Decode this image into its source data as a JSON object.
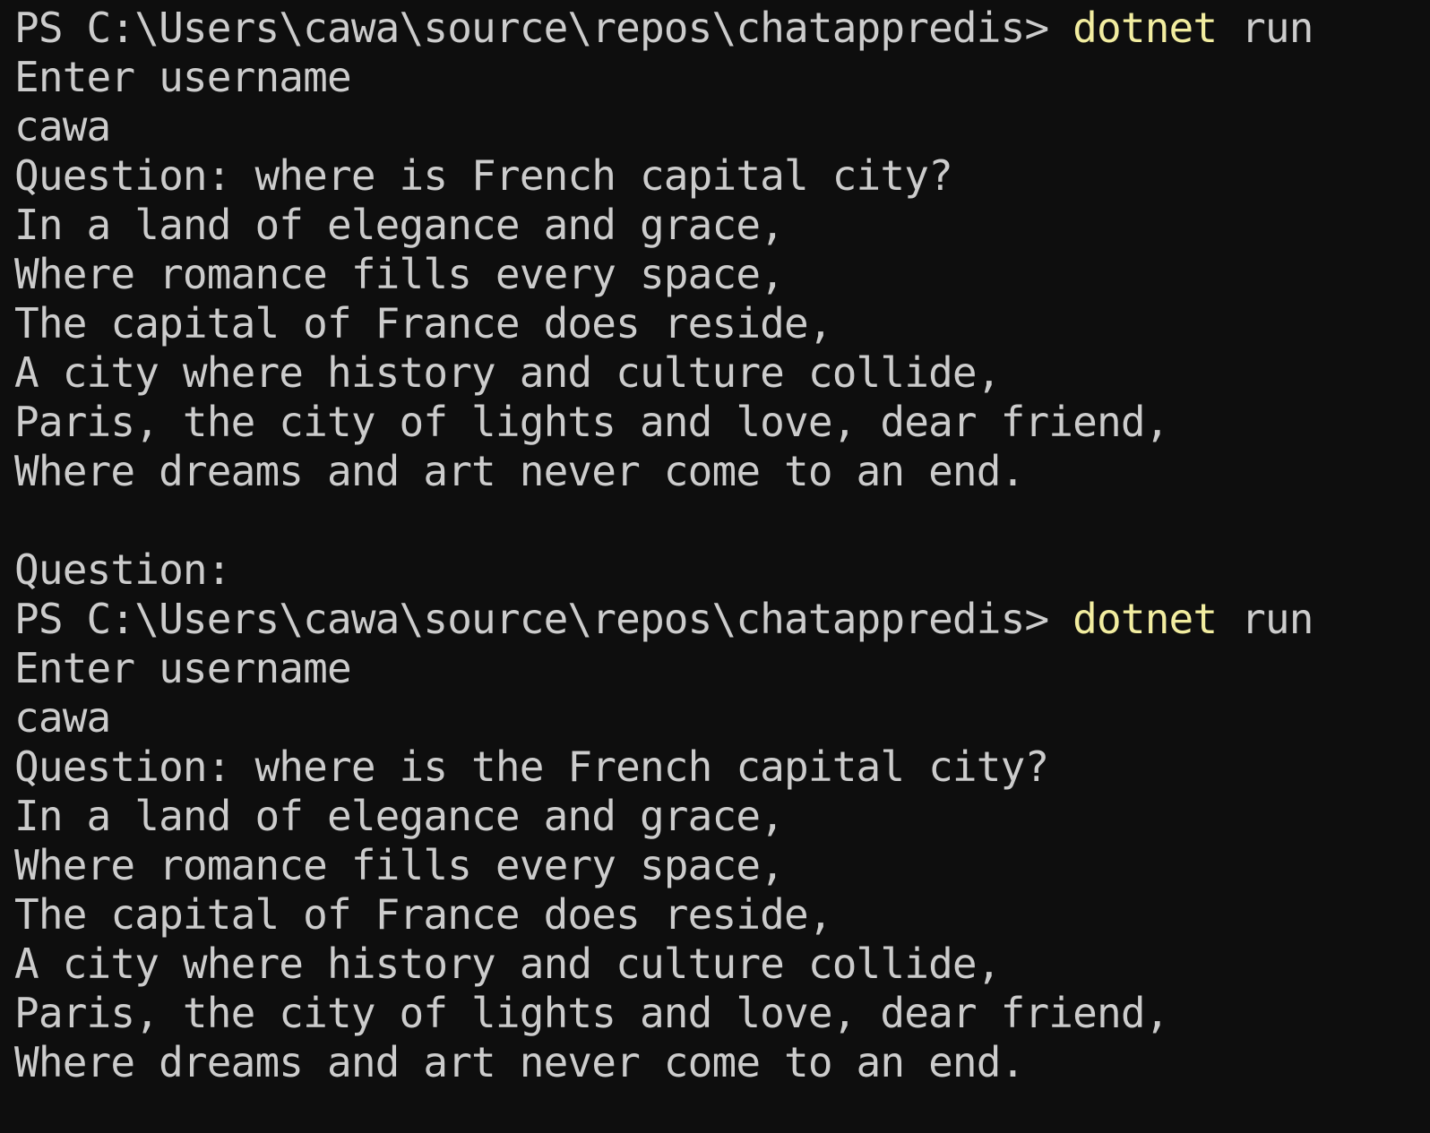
{
  "terminal": {
    "title": "Windows PowerShell",
    "colors": {
      "background": "#0e0e0e",
      "foreground": "#cccccc",
      "command_yellow": "#f2eda0"
    },
    "font_size_px": 46,
    "line_height_px": 55,
    "prompt": "PS C:\\Users\\cawa\\source\\repos\\chatappredis>",
    "command_name": "dotnet",
    "command_args": "run",
    "lines": [
      {
        "id": "line-1-prompt",
        "type": "prompt",
        "segments": [
          {
            "text": "PS C:\\Users\\cawa\\source\\repos\\chatappredis> ",
            "style": "default"
          },
          {
            "text": "dotnet",
            "style": "command"
          },
          {
            "text": " run",
            "style": "default"
          }
        ]
      },
      {
        "id": "line-2-output",
        "type": "output",
        "segments": [
          {
            "text": "Enter username",
            "style": "default"
          }
        ]
      },
      {
        "id": "line-3-input",
        "type": "input",
        "segments": [
          {
            "text": "cawa",
            "style": "default"
          }
        ]
      },
      {
        "id": "line-4-input",
        "type": "input",
        "segments": [
          {
            "text": "Question: where is French capital city?",
            "style": "default"
          }
        ]
      },
      {
        "id": "line-5-output",
        "type": "output",
        "segments": [
          {
            "text": "In a land of elegance and grace,",
            "style": "default"
          }
        ]
      },
      {
        "id": "line-6-output",
        "type": "output",
        "segments": [
          {
            "text": "Where romance fills every space,",
            "style": "default"
          }
        ]
      },
      {
        "id": "line-7-output",
        "type": "output",
        "segments": [
          {
            "text": "The capital of France does reside,",
            "style": "default"
          }
        ]
      },
      {
        "id": "line-8-output",
        "type": "output",
        "segments": [
          {
            "text": "A city where history and culture collide,",
            "style": "default"
          }
        ]
      },
      {
        "id": "line-9-output",
        "type": "output",
        "segments": [
          {
            "text": "Paris, the city of lights and love, dear friend,",
            "style": "default"
          }
        ]
      },
      {
        "id": "line-10-output",
        "type": "output",
        "segments": [
          {
            "text": "Where dreams and art never come to an end.",
            "style": "default"
          }
        ]
      },
      {
        "id": "line-11-blank",
        "type": "blank",
        "segments": [
          {
            "text": "",
            "style": "default"
          }
        ]
      },
      {
        "id": "line-12-output",
        "type": "output",
        "segments": [
          {
            "text": "Question:",
            "style": "default"
          }
        ]
      },
      {
        "id": "line-13-prompt",
        "type": "prompt",
        "segments": [
          {
            "text": "PS C:\\Users\\cawa\\source\\repos\\chatappredis> ",
            "style": "default"
          },
          {
            "text": "dotnet",
            "style": "command"
          },
          {
            "text": " run",
            "style": "default"
          }
        ]
      },
      {
        "id": "line-14-output",
        "type": "output",
        "segments": [
          {
            "text": "Enter username",
            "style": "default"
          }
        ]
      },
      {
        "id": "line-15-input",
        "type": "input",
        "segments": [
          {
            "text": "cawa",
            "style": "default"
          }
        ]
      },
      {
        "id": "line-16-input",
        "type": "input",
        "segments": [
          {
            "text": "Question: where is the French capital city?",
            "style": "default"
          }
        ]
      },
      {
        "id": "line-17-output",
        "type": "output",
        "segments": [
          {
            "text": "In a land of elegance and grace,",
            "style": "default"
          }
        ]
      },
      {
        "id": "line-18-output",
        "type": "output",
        "segments": [
          {
            "text": "Where romance fills every space,",
            "style": "default"
          }
        ]
      },
      {
        "id": "line-19-output",
        "type": "output",
        "segments": [
          {
            "text": "The capital of France does reside,",
            "style": "default"
          }
        ]
      },
      {
        "id": "line-20-output",
        "type": "output",
        "segments": [
          {
            "text": "A city where history and culture collide,",
            "style": "default"
          }
        ]
      },
      {
        "id": "line-21-output",
        "type": "output",
        "segments": [
          {
            "text": "Paris, the city of lights and love, dear friend,",
            "style": "default"
          }
        ]
      },
      {
        "id": "line-22-output",
        "type": "output",
        "segments": [
          {
            "text": "Where dreams and art never come to an end.",
            "style": "default"
          }
        ]
      }
    ]
  }
}
